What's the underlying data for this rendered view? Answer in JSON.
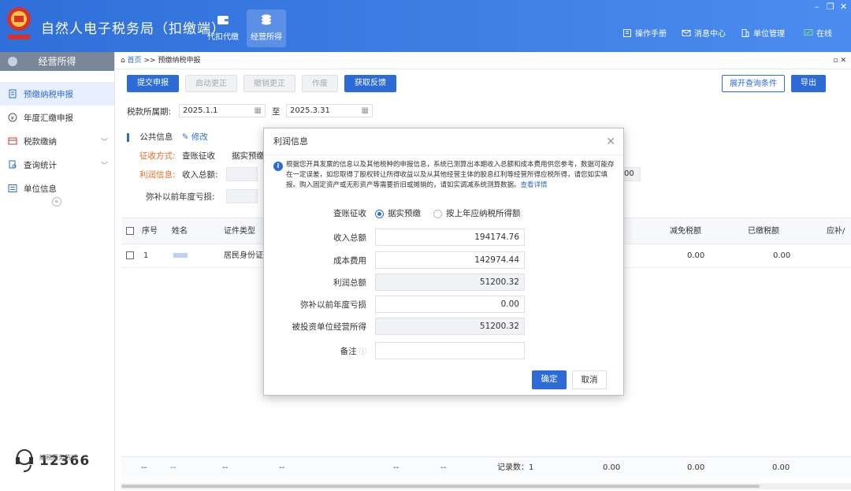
{
  "app": {
    "title": "自然人电子税务局（扣缴端）"
  },
  "nav_tabs": [
    {
      "label": "代扣代缴"
    },
    {
      "label": "经营所得"
    }
  ],
  "top_links": {
    "manual": "操作手册",
    "messages": "消息中心",
    "unit": "单位管理",
    "online": "在线"
  },
  "sidebar": {
    "header": "经营所得",
    "items": [
      {
        "label": "预缴纳税申报"
      },
      {
        "label": "年度汇缴申报"
      },
      {
        "label": "税款缴纳"
      },
      {
        "label": "查询统计"
      },
      {
        "label": "单位信息"
      }
    ],
    "hotline_label": "纳税服务热线",
    "hotline_number": "12366"
  },
  "breadcrumb": {
    "home": "首页",
    "sep": ">>",
    "current": "预缴纳税申报"
  },
  "toolbar": {
    "submit": "提交申报",
    "start_correct": "启动更正",
    "cancel_correct": "撤销更正",
    "void": "作废",
    "feedback": "获取反馈",
    "expand_query": "展开查询条件",
    "export": "导出"
  },
  "period": {
    "label": "税款所属期:",
    "start": "2025.1.1",
    "to": "至",
    "end": "2025.3.31"
  },
  "public_info": {
    "title": "公共信息",
    "edit": "修改",
    "method_label": "征收方式:",
    "method_value": "查账征收",
    "method_extra": "据实预缴",
    "profit_label": "利润信息:",
    "income_label": "收入总额:",
    "loss_label": "弥补以前年度亏损:",
    "partial_value": "00"
  },
  "table": {
    "headers": [
      "序号",
      "姓名",
      "证件类型",
      "减免税额",
      "已缴税额",
      "应补/"
    ],
    "rows": [
      {
        "index": "1",
        "name": "",
        "id_type": "居民身份证",
        "reduce": "0.00",
        "paid": "0.00"
      }
    ],
    "footer": {
      "c1": "--",
      "c2": "--",
      "c3": "--",
      "c4": "--",
      "c5": "--",
      "c6": "--",
      "count": "记录数：1",
      "v1": "0.00",
      "v2": "0.00",
      "v3": "0.00"
    }
  },
  "dialog": {
    "title": "利润信息",
    "notice": "根据您开具发票的信息以及其他税种的申报信息，系统已测算出本期收入总额和成本费用供您参考，数据可能存在一定误差，如您取得了股权转让所得收益以及从其他经营主体的股息红利等经营所得应税所得，请您如实填报。购入固定资产或无形资产等需要折旧或摊销的，请如实调减系统测算数据。",
    "notice_link": "查看详情",
    "method_label": "查账征收",
    "option1": "据实预缴",
    "option2": "按上年应纳税所得额",
    "income_label": "收入总额",
    "income": "194174.76",
    "cost_label": "成本费用",
    "cost": "142974.44",
    "profit_label": "利润总额",
    "profit": "51200.32",
    "loss_label": "弥补以前年度亏损",
    "loss": "0.00",
    "invested_label": "被投资单位经营所得",
    "invested": "51200.32",
    "remark_label": "备注",
    "remark": "",
    "confirm": "确定",
    "cancel": "取消"
  }
}
